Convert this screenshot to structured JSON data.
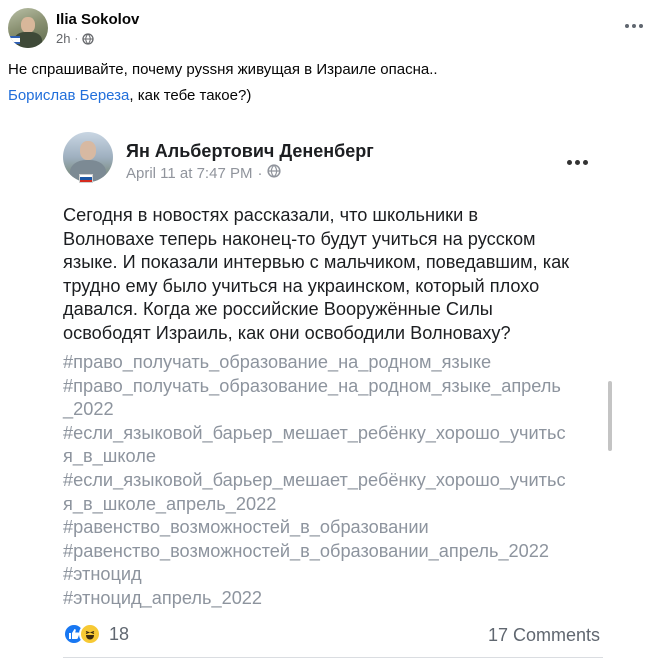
{
  "post": {
    "author": "Ilia Sokolov",
    "time": "2h",
    "caption_line1": "Не спрашивайте, почему руssня живущая в Израиле опасна..",
    "mention": "Борислав Береза",
    "caption_line2_rest": ", как тебе такое?)"
  },
  "embedded": {
    "author": "Ян Альбертович Дененберг",
    "timestamp": "April 11 at 7:47 PM",
    "separator": "·",
    "text_lines": [
      "Сегодня в новостях рассказали, что школьники в",
      "Волновахе теперь наконец-то будут учиться на русском",
      "языке. И показали интервью с мальчиком, поведавшим, как",
      "трудно ему было учиться на украинском, который плохо",
      "давался. Когда же российские Вооружённые Силы",
      "освободят Израиль, как они освободили Волноваху?"
    ],
    "hashtag_lines": [
      "#право_получать_образование_на_родном_языке",
      "#право_получать_образование_на_родном_языке_апрель",
      "_2022",
      "#если_языковой_барьер_мешает_ребёнку_хорошо_учитьс",
      "я_в_школе",
      "#если_языковой_барьер_мешает_ребёнку_хорошо_учитьс",
      "я_в_школе_апрель_2022",
      "#равенство_возможностей_в_образовании",
      "#равенство_возможностей_в_образовании_апрель_2022",
      "#этноцид",
      "#этноцид_апрель_2022"
    ],
    "reaction_count": "18",
    "comments": "17 Comments"
  },
  "icons": {
    "globe": "globe-icon",
    "more": "more-options-icon",
    "like": "like-reaction-icon",
    "haha": "haha-reaction-icon",
    "flag": "russia-flag-icon"
  },
  "colors": {
    "link": "#216fdb",
    "muted": "#65676b",
    "hashtag": "#8d949e",
    "like": "#1877f2",
    "haha": "#f7c934"
  }
}
